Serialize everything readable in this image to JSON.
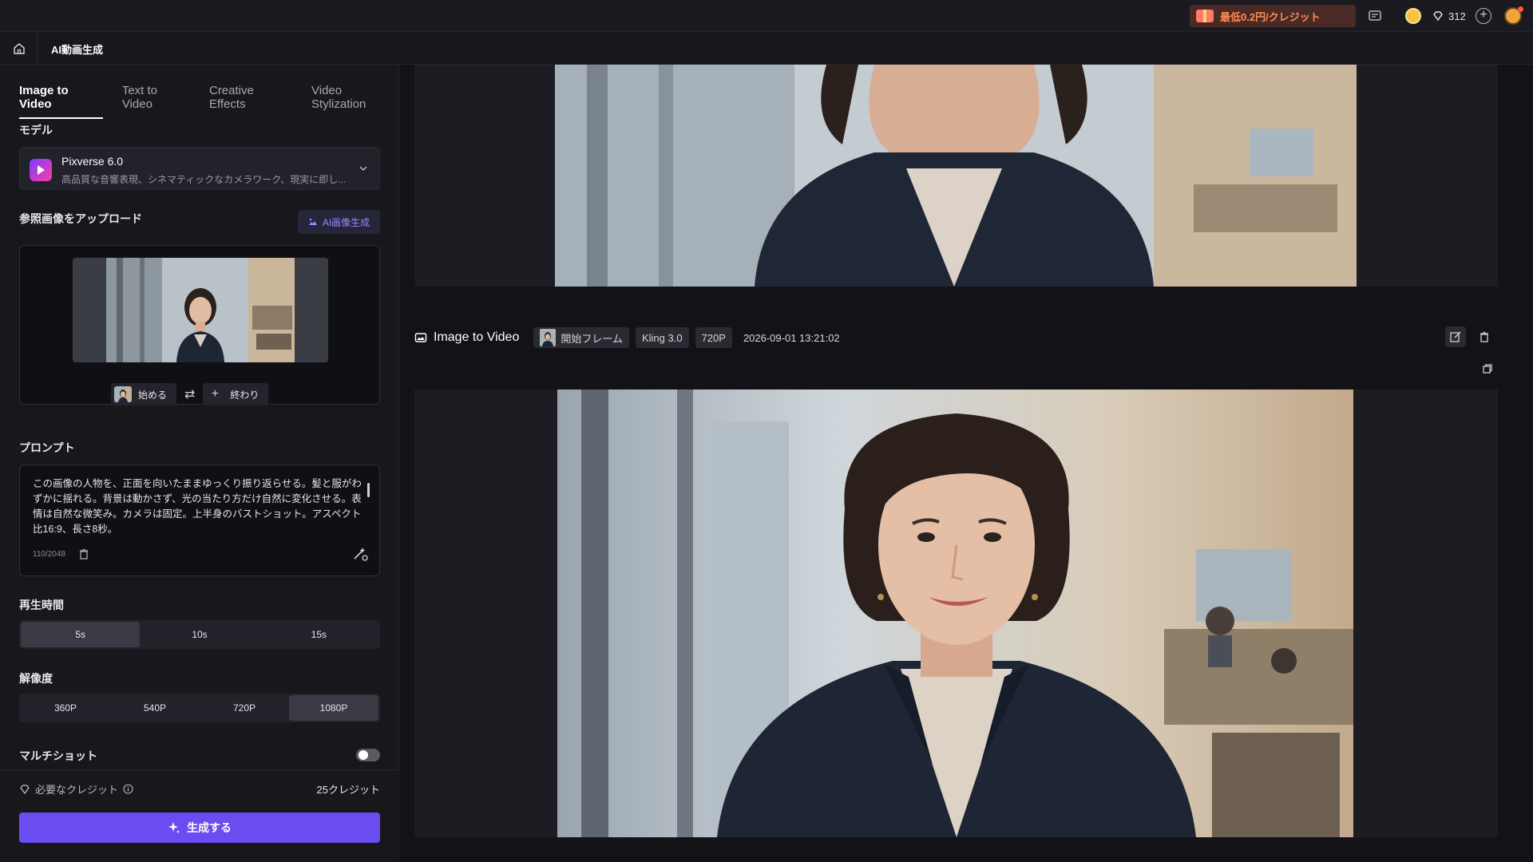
{
  "topbar": {
    "promo": "最低0.2円/クレジット",
    "credits": "312"
  },
  "subhead": {
    "title": "AI動画生成"
  },
  "left": {
    "tabs": [
      {
        "label": "Image to Video",
        "active": true
      },
      {
        "label": "Text to Video",
        "active": false
      },
      {
        "label": "Creative Effects",
        "active": false
      },
      {
        "label": "Video Stylization",
        "active": false
      }
    ],
    "model_label": "モデル",
    "model_name": "Pixverse 6.0",
    "model_desc": "高品質な音響表現、シネマティックなカメラワーク、現実に即し...",
    "upload_label": "参照画像をアップロード",
    "ai_image_btn": "AI画像生成",
    "start_label": "始める",
    "end_label": "終わり",
    "prompt_label": "プロンプト",
    "prompt_text": "この画像の人物を、正面を向いたままゆっくり振り返らせる。髪と服がわずかに揺れる。背景は動かさず、光の当たり方だけ自然に変化させる。表情は自然な微笑み。カメラは固定。上半身のバストショット。アスペクト比16:9、長さ8秒。",
    "prompt_count": "110/2048",
    "duration_label": "再生時間",
    "durations": [
      "5s",
      "10s",
      "15s"
    ],
    "duration_selected": 0,
    "resolution_label": "解像度",
    "resolutions": [
      "360P",
      "540P",
      "720P",
      "1080P"
    ],
    "resolution_selected": 3,
    "multishot_label": "マルチショット",
    "required_credit_label": "必要なクレジット",
    "required_credit_value": "25クレジット",
    "generate_label": "生成する"
  },
  "result": {
    "title": "Image to Video",
    "frame_chip": "開始フレーム",
    "model_chip": "Kling 3.0",
    "res_chip": "720P",
    "date": "2026-09-01 13:21:02"
  },
  "colors": {
    "accent": "#6a4cf0",
    "promo_text": "#ff8a55",
    "ai_btn_text": "#9a88ff"
  }
}
